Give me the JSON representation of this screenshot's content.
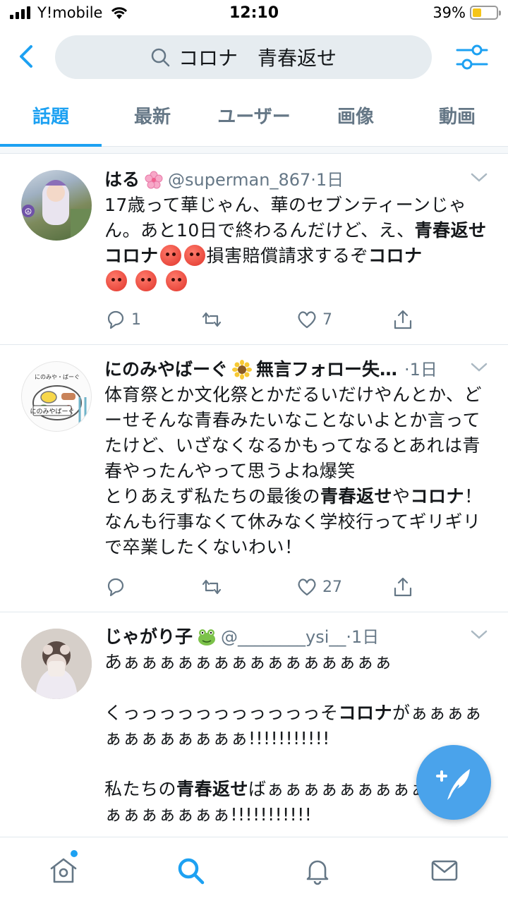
{
  "status_bar": {
    "carrier": "Y!mobile",
    "time": "12:10",
    "battery": "39%",
    "battery_level": 0.39
  },
  "search": {
    "query": "コロナ　青春返せ",
    "icons": [
      "back-arrow-icon",
      "search-icon",
      "filter-icon"
    ]
  },
  "tabs": [
    {
      "label": "話題",
      "active": true
    },
    {
      "label": "最新"
    },
    {
      "label": "ユーザー"
    },
    {
      "label": "画像"
    },
    {
      "label": "動画"
    }
  ],
  "tweets": [
    {
      "name": "はる",
      "emoji": "cherry-blossom",
      "handle": "@superman_867",
      "time": "·1日",
      "text_html": "17歳って華じゃん、華のセブンティーンじゃん。あと10日で終わるんだけど、え、<b>青春返せコロナ</b><span class=\"angry\"></span><span class=\"angry\"></span>損害賠償請求するぞ<b>コロナ</b><br><span class=\"angry\"></span> <span class=\"angry\"></span> <span class=\"angry\"></span>",
      "replies": "1",
      "retweets": "",
      "likes": "7"
    },
    {
      "name": "にのみやばーぐ",
      "emoji": "sunflower",
      "extra": "無言フォロー失…",
      "time": "·1日",
      "text_html": "体育祭とか文化祭とかだるいだけやんとか、どーせそんな青春みたいなことないよとか言ってたけど、いざなくなるかもってなるとあれは青春やったんやって思うよね爆笑<br>とりあえず私たちの最後の<b>青春返せ</b>や<b>コロナ</b>！なんも行事なくて休みなく学校行ってギリギリで卒業したくないわい！",
      "replies": "",
      "retweets": "",
      "likes": "27"
    },
    {
      "name": "じゃがり子",
      "emoji": "frog",
      "handle": "@________ysi__",
      "time": "·1日",
      "text_html": "あぁぁぁぁぁぁぁぁぁぁぁぁぁぁぁ<br><br>くっっっっっっっっっっっそ<b>コロナ</b>がぁぁぁぁぁぁぁぁぁぁぁぁ!!!!!!!!!!!<br><br>私たちの<b>青春返せ</b>ばぁぁぁぁぁぁぁぁぁぁぁぁぁぁぁぁぁぁぁ!!!!!!!!!!!"
    }
  ],
  "bottom_nav": [
    "home-icon",
    "search-icon",
    "notifications-icon",
    "messages-icon"
  ],
  "colors": {
    "accent": "#1da1f2",
    "fab": "#4aa3eb",
    "muted": "#657786"
  }
}
